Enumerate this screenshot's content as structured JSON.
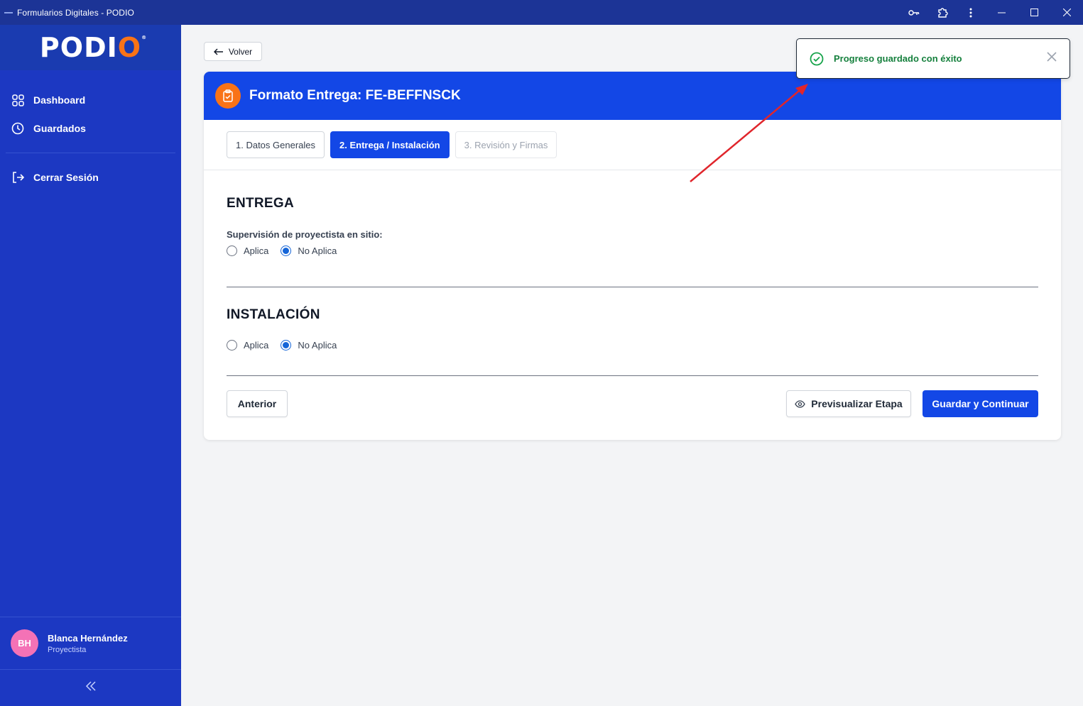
{
  "window": {
    "title": "Formularios Digitales - PODIO",
    "controls": [
      "key-icon",
      "extensions-icon",
      "more-icon",
      "minimize-icon",
      "maximize-icon",
      "close-icon"
    ]
  },
  "sidebar": {
    "logo": {
      "text_main": "PODI",
      "text_accent": "O",
      "reg": "®"
    },
    "items": [
      {
        "label": "Dashboard",
        "icon": "grid-icon"
      },
      {
        "label": "Guardados",
        "icon": "clock-icon"
      },
      {
        "label": "Cerrar Sesión",
        "icon": "logout-icon"
      }
    ],
    "user": {
      "initials": "BH",
      "name": "Blanca Hernández",
      "role": "Proyectista"
    },
    "collapse_icon": "double-chevron-left-icon"
  },
  "main": {
    "back_label": "Volver",
    "form_title": "Formato Entrega: FE-BEFFNSCK",
    "tabs": [
      {
        "label": "1. Datos Generales",
        "state": "default"
      },
      {
        "label": "2. Entrega / Instalación",
        "state": "active"
      },
      {
        "label": "3. Revisión y Firmas",
        "state": "disabled"
      }
    ],
    "entrega": {
      "title": "ENTREGA",
      "field_label": "Supervisión de proyectista en sitio:",
      "options": [
        "Aplica",
        "No Aplica"
      ],
      "selected": "No Aplica"
    },
    "instalacion": {
      "title": "INSTALACIÓN",
      "options": [
        "Aplica",
        "No Aplica"
      ],
      "selected": "No Aplica"
    },
    "buttons": {
      "previous": "Anterior",
      "preview": "Previsualizar Etapa",
      "save_continue": "Guardar y Continuar"
    }
  },
  "toast": {
    "message": "Progreso guardado con éxito",
    "status": "success",
    "color": "#15803d"
  },
  "colors": {
    "sidebar": "#1c38c2",
    "primary": "#1347e6",
    "accent_orange": "#f97316",
    "annotation_arrow": "#e0252b"
  }
}
